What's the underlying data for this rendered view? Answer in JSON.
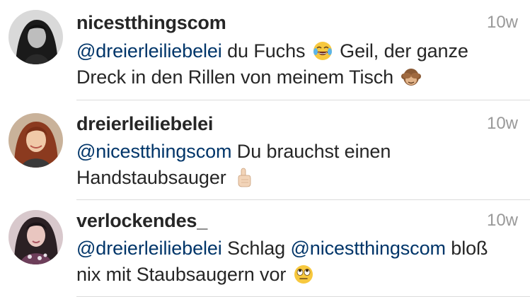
{
  "comments": [
    {
      "username": "nicestthingscom",
      "time": "10w",
      "mention": "@dreierleiliebelei",
      "text_a": " du Fuchs ",
      "emoji_a": "face-with-tears-of-joy-emoji",
      "text_b": " Geil, der ganze Dreck in den Rillen von meinem Tisch ",
      "emoji_b": "see-no-evil-monkey-emoji"
    },
    {
      "username": "dreierleiliebelei",
      "time": "10w",
      "mention": "@nicestthingscom",
      "text_a": " Du brauchst einen Handstaubsauger ",
      "emoji_a": "index-pointing-up-emoji"
    },
    {
      "username": "verlockendes_",
      "time": "10w",
      "mention": "@dreierleiliebelei",
      "text_a": " Schlag ",
      "mention_b": "@nicestthingscom",
      "text_b": " bloß nix mit Staubsaugern vor ",
      "emoji_a": "face-with-rolling-eyes-emoji"
    }
  ],
  "colors": {
    "mention": "#003569",
    "timestamp": "#999999",
    "divider": "#dbdbdb",
    "text": "#262626"
  }
}
